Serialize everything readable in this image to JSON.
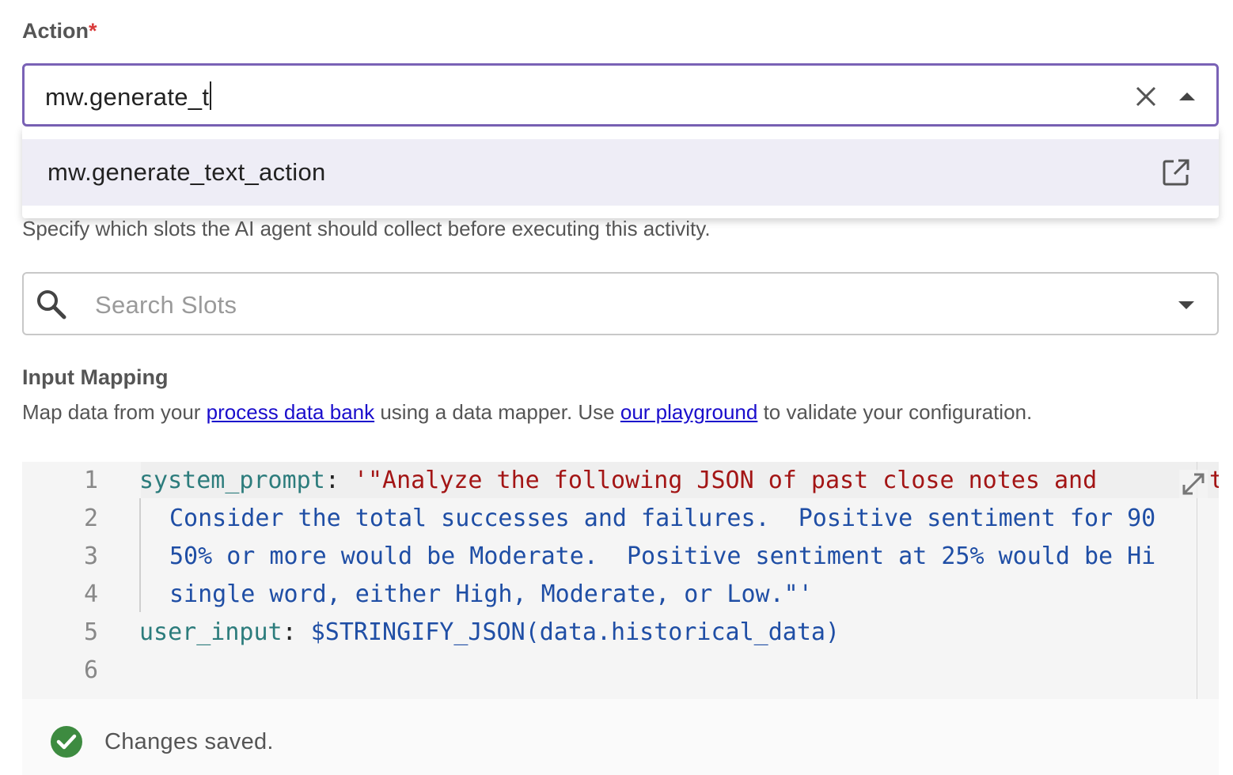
{
  "action_field": {
    "label": "Action",
    "required_mark": "*",
    "value": "mw.generate_t",
    "clear_icon": "close-icon",
    "toggle_icon": "caret-up-icon"
  },
  "action_dropdown": {
    "options": [
      {
        "label": "mw.generate_text_action",
        "icon": "open-in-new-icon"
      }
    ]
  },
  "slots": {
    "help_text": "Specify which slots the AI agent should collect before executing this activity.",
    "placeholder": "Search Slots",
    "search_icon": "search-icon",
    "toggle_icon": "caret-down-icon"
  },
  "input_mapping": {
    "title": "Input Mapping",
    "desc_prefix": "Map data from your ",
    "link1": "process data bank",
    "desc_middle": " using a data mapper. Use ",
    "link2": "our playground",
    "desc_suffix": " to validate your configuration."
  },
  "editor": {
    "line_numbers": [
      "1",
      "2",
      "3",
      "4",
      "5",
      "6"
    ],
    "line1_key": "system_prompt",
    "line1_colon": ": ",
    "line1_string": "'\"Analyze the following JSON of past close notes and ",
    "line1_tail": "t",
    "line2": "Consider the total successes and failures.  Positive sentiment for 90",
    "line3": "50% or more would be Moderate.  Positive sentiment at 25% would be Hi",
    "line4": "single word, either High, Moderate, or Low.\"'",
    "line5_key": "user_input",
    "line5_colon": ": ",
    "line5_value": "$STRINGIFY_JSON(data.historical_data)",
    "fullscreen_icon": "expand-icon"
  },
  "status": {
    "text": "Changes saved.",
    "icon": "check-circle-icon",
    "icon_color": "#3d8b40"
  },
  "colors": {
    "focus_border": "#7a62b6",
    "required": "#d93a3a",
    "link": "#1a0dcc",
    "option_highlight": "#eeedf6"
  }
}
